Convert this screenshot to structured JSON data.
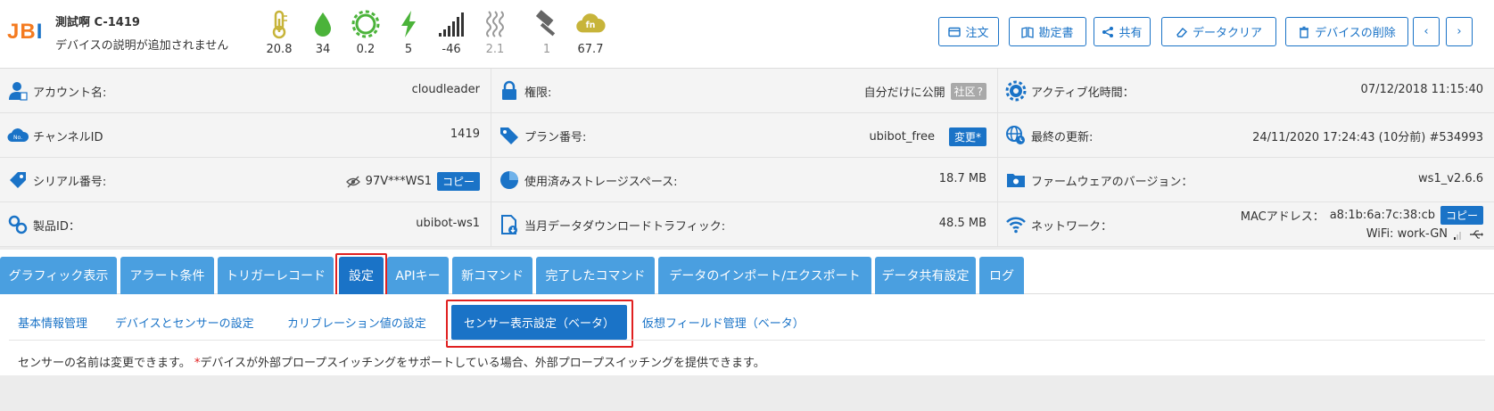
{
  "header": {
    "logo_part1": "JB",
    "logo_part2": "I",
    "device_name": "測試啊 C-1419",
    "device_desc": "デバイスの説明が追加されません"
  },
  "sensors": [
    {
      "icon": "thermometer-icon",
      "value": "20.8",
      "color": "#c7b43a"
    },
    {
      "icon": "humidity-drop-icon",
      "value": "34",
      "color": "#4bb33a"
    },
    {
      "icon": "light-gear-icon",
      "value": "0.2",
      "color": "#4bb33a"
    },
    {
      "icon": "voltage-bolt-icon",
      "value": "5",
      "color": "#4bb33a"
    },
    {
      "icon": "signal-bars-icon",
      "value": "-46",
      "color": "#333333"
    },
    {
      "icon": "vibration-icon",
      "value": "2.1",
      "color": "#999999"
    },
    {
      "icon": "knock-hammer-icon",
      "value": "1",
      "color": "#666666"
    },
    {
      "icon": "fn-cloud-icon",
      "value": "67.7",
      "color": "#c7b43a",
      "badge": "fn"
    }
  ],
  "actions": {
    "order": "注文",
    "manual": "勘定書",
    "share": "共有",
    "clear_data": "データクリア",
    "delete_device": "デバイスの削除",
    "prev": "‹",
    "next": "›"
  },
  "info": {
    "account_label": "アカウント名:",
    "account_value": "cloudleader",
    "channel_label": "チャンネルID",
    "channel_value": "1419",
    "serial_label": "シリアル番号:",
    "serial_value": "97V***WS1",
    "copy": "コピー",
    "product_label": "製品ID：",
    "product_value": "ubibot-ws1",
    "permission_label": "権限:",
    "permission_value": "自分だけに公開",
    "community_badge": "社区",
    "plan_label": "プラン番号:",
    "plan_value": "ubibot_free",
    "change": "変更*",
    "storage_label": "使用済みストレージスペース:",
    "storage_value": "18.7 MB",
    "traffic_label": "当月データダウンロードトラフィック:",
    "traffic_value": "48.5 MB",
    "activation_label": "アクティブ化時間：",
    "activation_value": "07/12/2018 11:15:40",
    "last_update_label": "最終の更新:",
    "last_update_value": "24/11/2020 17:24:43 (10分前) #534993",
    "firmware_label": "ファームウェアのバージョン：",
    "firmware_value": "ws1_v2.6.6",
    "network_label": "ネットワーク：",
    "mac_label": "MACアドレス：",
    "mac_value": "a8:1b:6a:7c:38:cb",
    "wifi_value": "WiFi: work-GN"
  },
  "tabs": [
    "グラフィック表示",
    "アラート条件",
    "トリガーレコード",
    "設定",
    "APIキー",
    "新コマンド",
    "完了したコマンド",
    "データのインポート/エクスポート",
    "データ共有設定",
    "ログ"
  ],
  "subtabs": [
    "基本情報管理",
    "デバイスとセンサーの設定",
    "カリブレーション値の設定",
    "センサー表示設定（ベータ）",
    "仮想フィールド管理（ベータ）"
  ],
  "notice": {
    "text1": "センサーの名前は変更できます。",
    "star": "*",
    "text2": "デバイスが外部プロープスイッチングをサポートしている場合、外部プロープスイッチングを提供できます。"
  },
  "colors": {
    "primary": "#1a73c7",
    "tab": "#4a9fe0",
    "highlight": "#e02020"
  }
}
